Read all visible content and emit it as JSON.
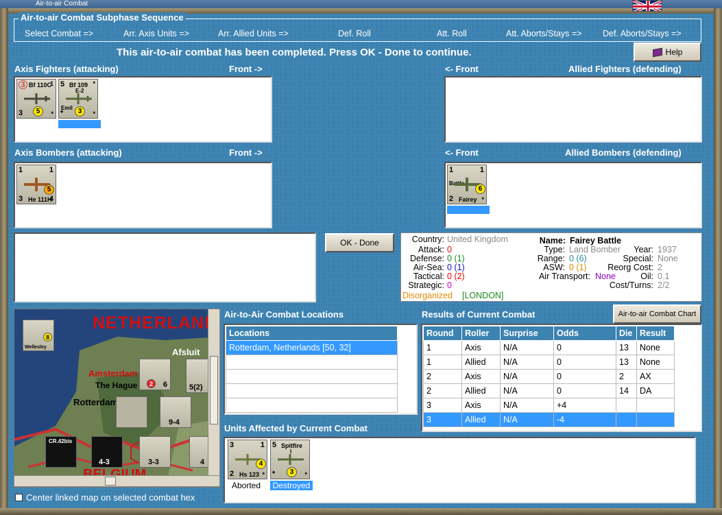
{
  "window": {
    "title": "Air-to-air Combat"
  },
  "sequence": {
    "title": "Air-to-air Combat Subphase Sequence",
    "steps": [
      "Select Combat =>",
      "Arr. Axis Units =>",
      "Arr. Allied Units =>",
      "Def. Roll",
      "Att. Roll",
      "Att. Aborts/Stays =>",
      "Def. Aborts/Stays =>"
    ]
  },
  "message": "This air-to-air combat has been completed.  Press OK - Done to continue.",
  "help_label": "Help",
  "ok_label": "OK - Done",
  "axis_fighters": {
    "header": "Axis Fighters (attacking)",
    "front": "Front ->",
    "units": [
      {
        "top_left": "3",
        "name": "Bf 110C",
        "num": "1",
        "bottom_left": "3",
        "circle": "5",
        "bottom_right": "*"
      },
      {
        "top_left": "5",
        "name": "Bf 109",
        "sub": "E-2",
        "label": "Emil",
        "bottom_left": "*",
        "circle": "3",
        "bottom_right": "*",
        "top_right": "*"
      }
    ]
  },
  "allied_fighters": {
    "header": "Allied Fighters (defending)",
    "front": "<- Front"
  },
  "axis_bombers": {
    "header": "Axis Bombers (attacking)",
    "front": "Front ->",
    "units": [
      {
        "top_left": "1",
        "top_right": "1",
        "bottom_left": "3",
        "name": "He 111H",
        "bottom_right": "4",
        "circle": "5"
      }
    ]
  },
  "allied_bombers": {
    "header": "Allied Bombers (defending)",
    "front": "<- Front",
    "units": [
      {
        "top_left": "1",
        "top_right": "1",
        "label": "Battle",
        "circle": "6",
        "bottom_left": "2",
        "name": "Fairey",
        "bottom_right": "*"
      }
    ]
  },
  "unit_info": {
    "country_lbl": "Country:",
    "country": "United Kingdom",
    "attack_lbl": "Attack:",
    "attack": "0",
    "defense_lbl": "Defense:",
    "defense": "0 (1)",
    "airsea_lbl": "Air-Sea:",
    "airsea": "0 (1)",
    "tactical_lbl": "Tactical:",
    "tactical": "0 (2)",
    "strategic_lbl": "Strategic:",
    "strategic": "0",
    "status": "Disorganized",
    "location": "[LONDON]",
    "name_lbl": "Name:",
    "name": "Fairey Battle",
    "type_lbl": "Type:",
    "type": "Land Bomber",
    "year_lbl": "Year:",
    "year": "1937",
    "range_lbl": "Range:",
    "range": "0 (6)",
    "special_lbl": "Special:",
    "special": "None",
    "asw_lbl": "ASW:",
    "asw": "0 (1)",
    "reorg_lbl": "Reorg Cost:",
    "reorg": "2",
    "airtransport_lbl": "Air Transport:",
    "airtransport": "None",
    "oil_lbl": "Oil:",
    "oil": "0.1",
    "costturns_lbl": "Cost/Turns:",
    "costturns": "2/2"
  },
  "map": {
    "country_label": "NETHERLANDS",
    "places": [
      "Amsterdam",
      "The Hague",
      "Rotterdam",
      "Afsluit",
      "BELGIUM"
    ],
    "counter_names": [
      "Wellesley",
      "CR.42bis"
    ],
    "counter_values": [
      "8",
      "2",
      "6",
      "5(2)",
      "9-4",
      "4-3",
      "3-3",
      "4"
    ]
  },
  "center_checkbox_label": "Center linked map on selected combat hex",
  "locations": {
    "header": "Air-to-Air Combat Locations",
    "col": "Locations",
    "rows": [
      "Rotterdam, Netherlands [50, 32]"
    ]
  },
  "results": {
    "header": "Results of Current Combat",
    "chart_button": "Air-to-air Combat Chart",
    "columns": [
      "Round",
      "Roller",
      "Surprise",
      "Odds",
      "Die",
      "Result"
    ],
    "rows": [
      [
        "1",
        "Axis",
        "N/A",
        "0",
        "13",
        "None"
      ],
      [
        "1",
        "Allied",
        "N/A",
        "0",
        "13",
        "None"
      ],
      [
        "2",
        "Axis",
        "N/A",
        "0",
        "2",
        "AX"
      ],
      [
        "2",
        "Allied",
        "N/A",
        "0",
        "14",
        "DA"
      ],
      [
        "3",
        "Axis",
        "N/A",
        "+4",
        "",
        ""
      ],
      [
        "3",
        "Allied",
        "N/A",
        "-4",
        "",
        ""
      ]
    ]
  },
  "affected": {
    "header": "Units Affected by Current Combat",
    "units": [
      {
        "top_left": "3",
        "top_right": "1",
        "bottom_left": "2",
        "name": "Hs 123",
        "circle": "4",
        "bottom_right": "*",
        "status": "Aborted"
      },
      {
        "top_left": "5",
        "name": "Spitfire",
        "sub": "I",
        "bottom_left": "*",
        "circle": "3",
        "bottom_right": "*",
        "status": "Destroyed"
      }
    ]
  }
}
